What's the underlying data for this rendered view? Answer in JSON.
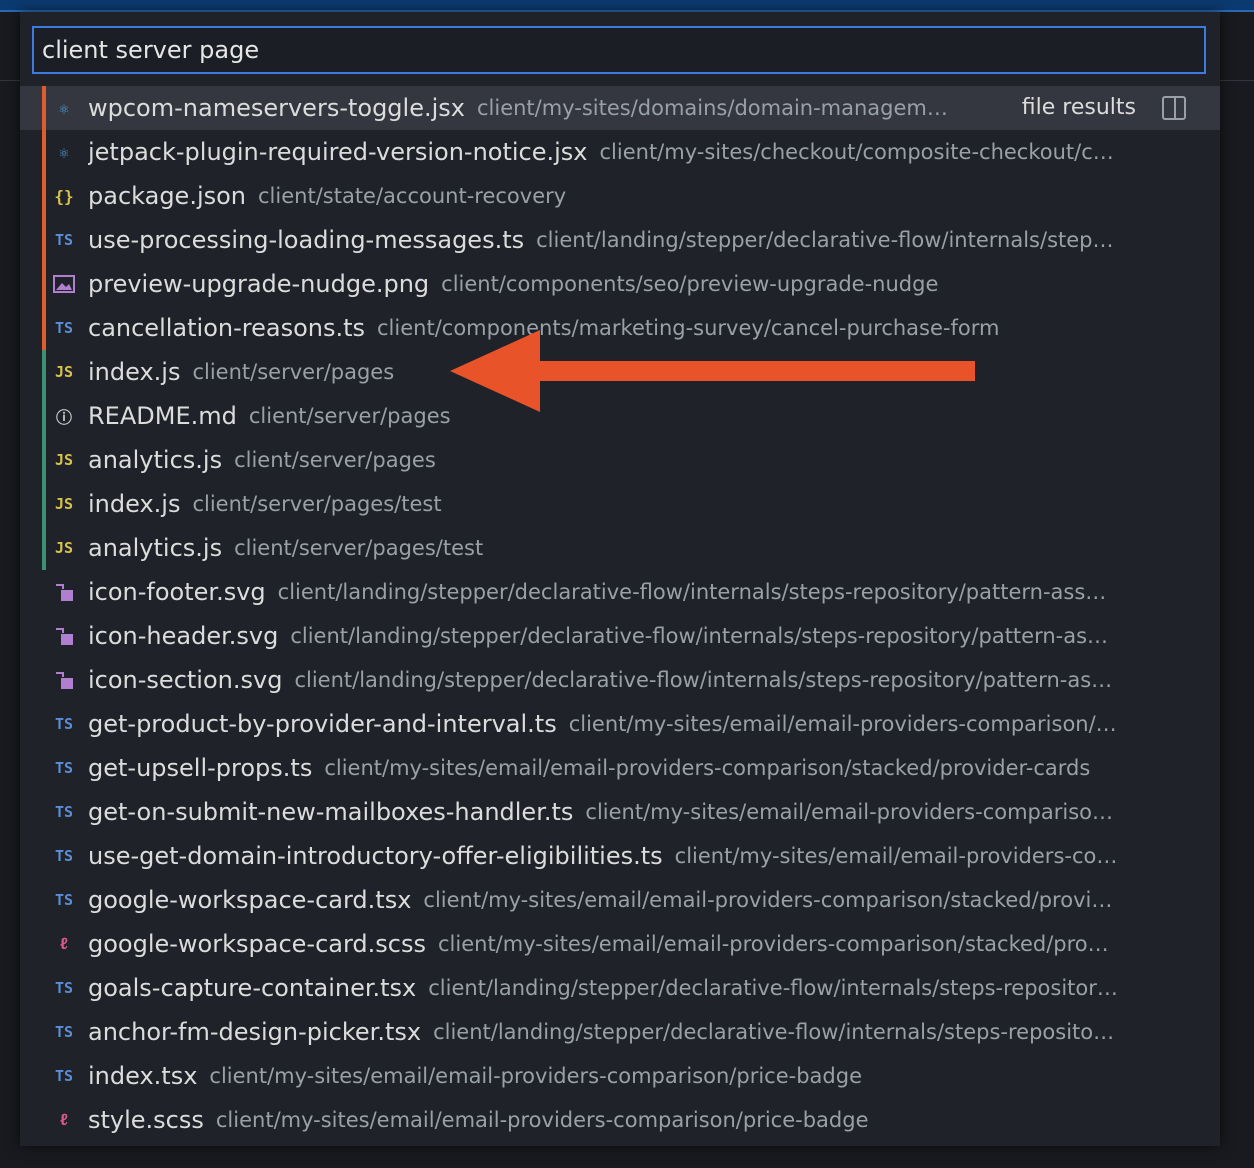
{
  "search": {
    "value": "client server page"
  },
  "results_label": "file results",
  "colors": {
    "accent": "#3d7be0",
    "orange": "#dd5e2c",
    "green": "#3e8f73"
  },
  "rows": [
    {
      "name": "wpcom-nameservers-toggle.jsx",
      "path": "client/my-sites/domains/domain-managem…",
      "icon": "react-icon",
      "glyph": "⚛",
      "type": "react",
      "bar": "orange",
      "selected": true
    },
    {
      "name": "jetpack-plugin-required-version-notice.jsx",
      "path": "client/my-sites/checkout/composite-checkout/c…",
      "icon": "react-icon",
      "glyph": "⚛",
      "type": "react",
      "bar": "orange"
    },
    {
      "name": "package.json",
      "path": "client/state/account-recovery",
      "icon": "json-icon",
      "glyph": "{}",
      "type": "json",
      "bar": "orange"
    },
    {
      "name": "use-processing-loading-messages.ts",
      "path": "client/landing/stepper/declarative-flow/internals/step…",
      "icon": "typescript-icon",
      "glyph": "TS",
      "type": "ts",
      "bar": "orange"
    },
    {
      "name": "preview-upgrade-nudge.png",
      "path": "client/components/seo/preview-upgrade-nudge",
      "icon": "image-icon",
      "glyph": "",
      "type": "image",
      "bar": "orange"
    },
    {
      "name": "cancellation-reasons.ts",
      "path": "client/components/marketing-survey/cancel-purchase-form",
      "icon": "typescript-icon",
      "glyph": "TS",
      "type": "ts",
      "bar": "orange"
    },
    {
      "name": "index.js",
      "path": "client/server/pages",
      "icon": "javascript-icon",
      "glyph": "JS",
      "type": "js",
      "bar": "green"
    },
    {
      "name": "README.md",
      "path": "client/server/pages",
      "icon": "info-icon",
      "glyph": "ⓘ",
      "type": "info",
      "bar": "green"
    },
    {
      "name": "analytics.js",
      "path": "client/server/pages",
      "icon": "javascript-icon",
      "glyph": "JS",
      "type": "js",
      "bar": "green"
    },
    {
      "name": "index.js",
      "path": "client/server/pages/test",
      "icon": "javascript-icon",
      "glyph": "JS",
      "type": "js",
      "bar": "green"
    },
    {
      "name": "analytics.js",
      "path": "client/server/pages/test",
      "icon": "javascript-icon",
      "glyph": "JS",
      "type": "js",
      "bar": "green"
    },
    {
      "name": "icon-footer.svg",
      "path": "client/landing/stepper/declarative-flow/internals/steps-repository/pattern-ass…",
      "icon": "svg-icon",
      "glyph": "",
      "type": "svg",
      "bar": ""
    },
    {
      "name": "icon-header.svg",
      "path": "client/landing/stepper/declarative-flow/internals/steps-repository/pattern-as…",
      "icon": "svg-icon",
      "glyph": "",
      "type": "svg",
      "bar": ""
    },
    {
      "name": "icon-section.svg",
      "path": "client/landing/stepper/declarative-flow/internals/steps-repository/pattern-as…",
      "icon": "svg-icon",
      "glyph": "",
      "type": "svg",
      "bar": ""
    },
    {
      "name": "get-product-by-provider-and-interval.ts",
      "path": "client/my-sites/email/email-providers-comparison/…",
      "icon": "typescript-icon",
      "glyph": "TS",
      "type": "ts",
      "bar": ""
    },
    {
      "name": "get-upsell-props.ts",
      "path": "client/my-sites/email/email-providers-comparison/stacked/provider-cards",
      "icon": "typescript-icon",
      "glyph": "TS",
      "type": "ts",
      "bar": ""
    },
    {
      "name": "get-on-submit-new-mailboxes-handler.ts",
      "path": "client/my-sites/email/email-providers-compariso…",
      "icon": "typescript-icon",
      "glyph": "TS",
      "type": "ts",
      "bar": ""
    },
    {
      "name": "use-get-domain-introductory-offer-eligibilities.ts",
      "path": "client/my-sites/email/email-providers-co…",
      "icon": "typescript-icon",
      "glyph": "TS",
      "type": "ts",
      "bar": ""
    },
    {
      "name": "google-workspace-card.tsx",
      "path": "client/my-sites/email/email-providers-comparison/stacked/provi…",
      "icon": "typescript-icon",
      "glyph": "TS",
      "type": "ts",
      "bar": ""
    },
    {
      "name": "google-workspace-card.scss",
      "path": "client/my-sites/email/email-providers-comparison/stacked/pro…",
      "icon": "sass-icon",
      "glyph": "ℓ",
      "type": "sass",
      "bar": ""
    },
    {
      "name": "goals-capture-container.tsx",
      "path": "client/landing/stepper/declarative-flow/internals/steps-repositor…",
      "icon": "typescript-icon",
      "glyph": "TS",
      "type": "ts",
      "bar": ""
    },
    {
      "name": "anchor-fm-design-picker.tsx",
      "path": "client/landing/stepper/declarative-flow/internals/steps-reposito…",
      "icon": "typescript-icon",
      "glyph": "TS",
      "type": "ts",
      "bar": ""
    },
    {
      "name": "index.tsx",
      "path": "client/my-sites/email/email-providers-comparison/price-badge",
      "icon": "typescript-icon",
      "glyph": "TS",
      "type": "ts",
      "bar": ""
    },
    {
      "name": "style.scss",
      "path": "client/my-sites/email/email-providers-comparison/price-badge",
      "icon": "sass-icon",
      "glyph": "ℓ",
      "type": "sass",
      "bar": ""
    }
  ]
}
